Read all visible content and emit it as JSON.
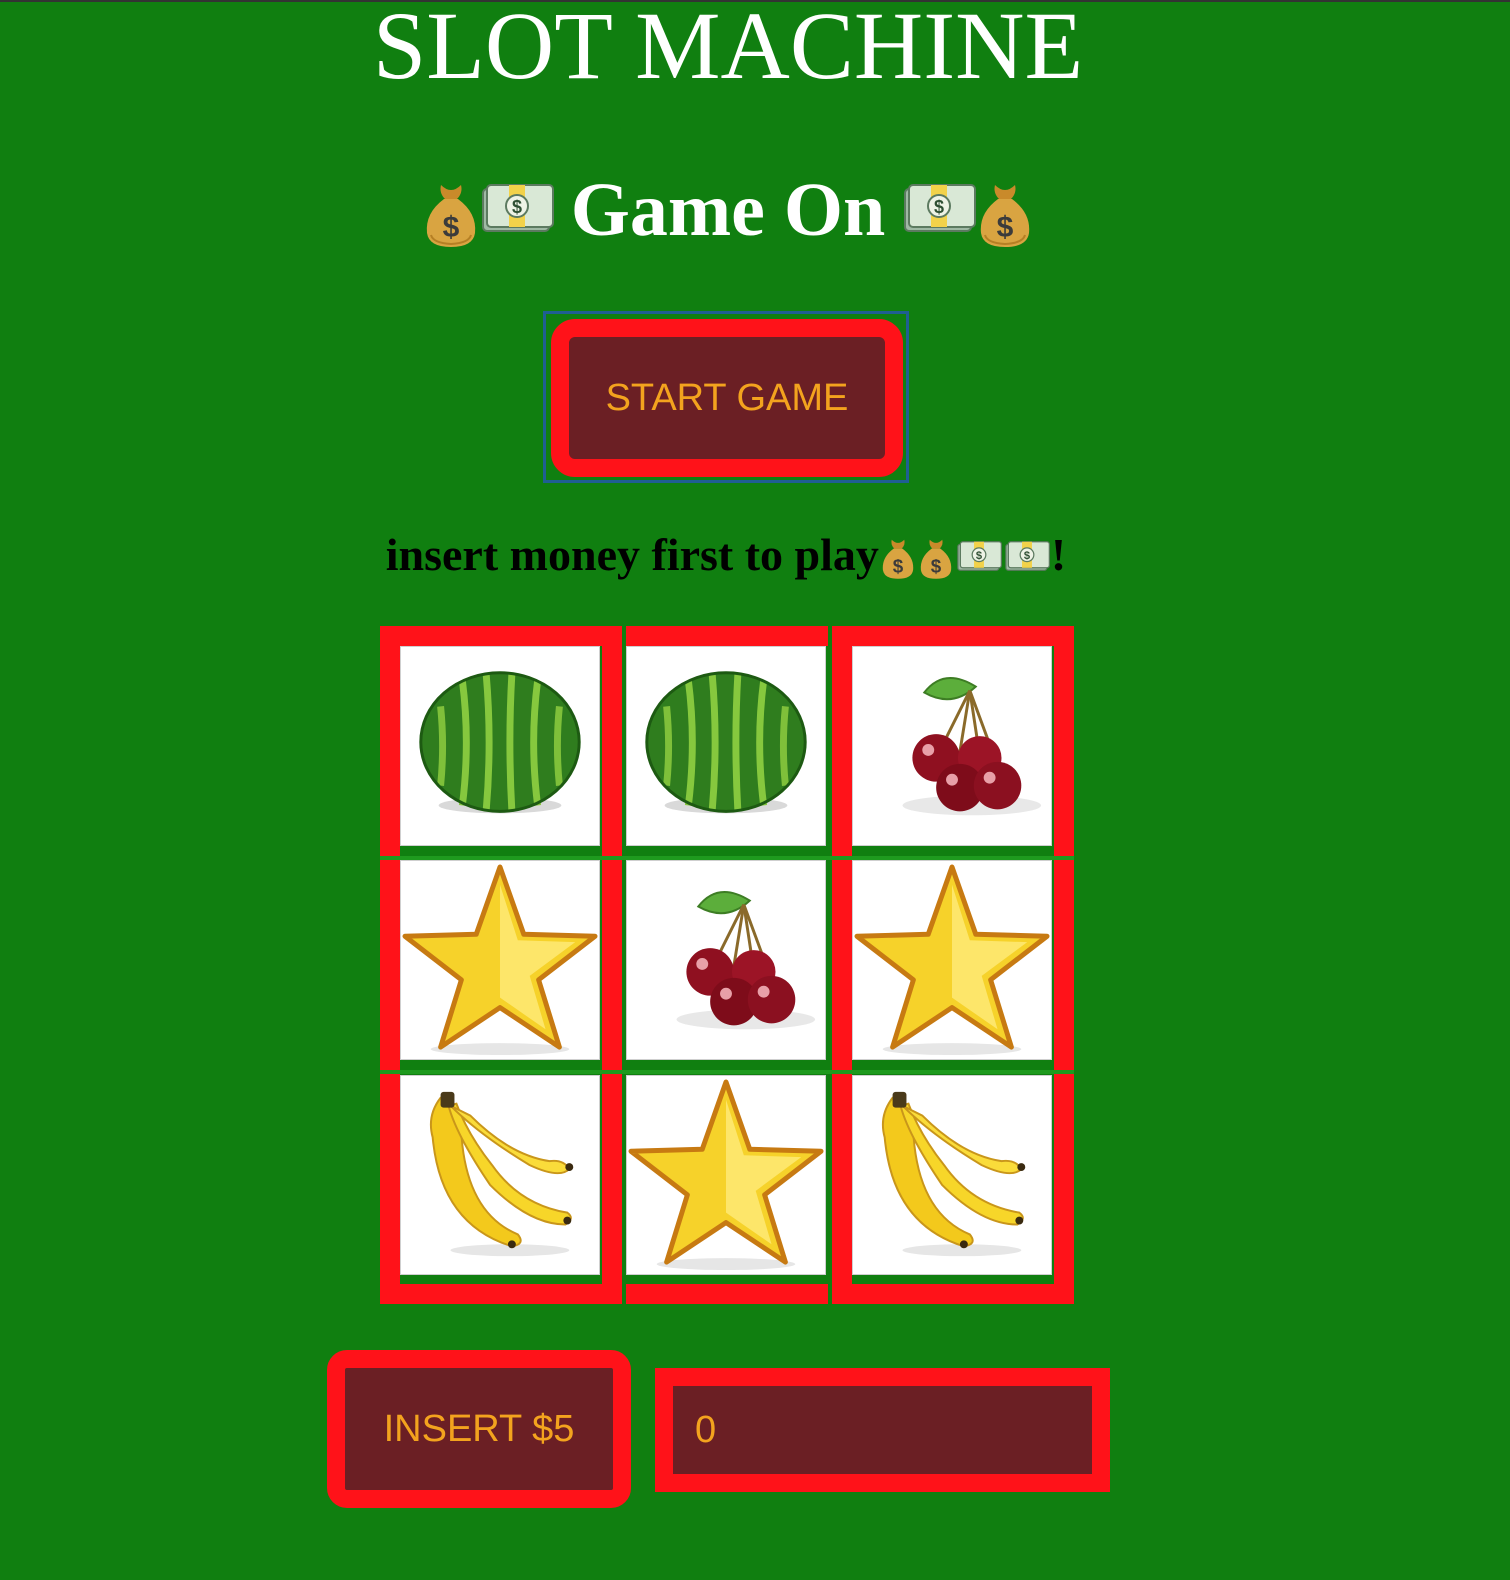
{
  "header": {
    "title": "SLOT MACHINE",
    "subtitle": "Game On"
  },
  "controls": {
    "start_label": "START GAME",
    "instruction_text": "insert money first to play",
    "instruction_end": "!",
    "insert_label": "INSERT $5",
    "balance_value": "0"
  },
  "icons": {
    "money_bag": "money-bag-icon",
    "cash": "dollar-banknote-icon"
  },
  "reels": [
    [
      "watermelon",
      "star",
      "banana"
    ],
    [
      "watermelon",
      "cherries",
      "star"
    ],
    [
      "cherries",
      "star",
      "banana"
    ]
  ],
  "colors": {
    "background": "#107f10",
    "border_red": "#ff1219",
    "button_bg": "#6b1f24",
    "button_text": "#f3a31e"
  }
}
